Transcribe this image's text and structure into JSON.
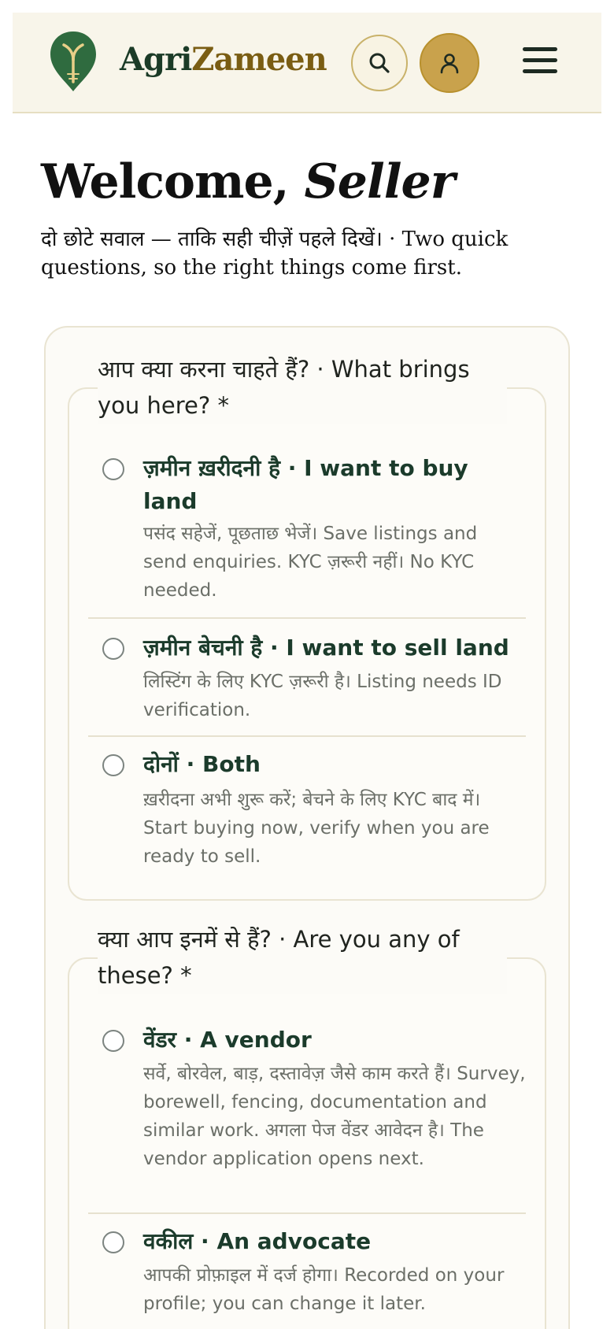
{
  "header": {
    "brand_part1": "Agri",
    "brand_part2": "Zameen",
    "logo_icon": "sprout-pin-icon",
    "search_icon": "search-icon",
    "account_icon": "user-icon",
    "menu_icon": "hamburger-menu-icon"
  },
  "colors": {
    "header_bg": "#f8f5ea",
    "brand_green": "#1b3b27",
    "brand_gold": "#7a5d13",
    "account_gold": "#c9a24c"
  },
  "welcome": {
    "prefix": "Welcome, ",
    "name": "Seller",
    "subtitle": "दो छोटे सवाल — ताकि सही चीज़ें पहले दिखें। · Two quick questions, so the right things come first."
  },
  "question1": {
    "legend": "आप क्या करना चाहते हैं? · What brings you here? *",
    "options": [
      {
        "title": "ज़मीन ख़रीदनी है · I want to buy land",
        "description": "पसंद सहेजें, पूछताछ भेजें। Save listings and send enquiries. KYC ज़रूरी नहीं। No KYC needed."
      },
      {
        "title": "ज़मीन बेचनी है · I want to sell land",
        "description": "लिस्टिंग के लिए KYC ज़रूरी है। Listing needs ID verification."
      },
      {
        "title": "दोनों · Both",
        "description": "ख़रीदना अभी शुरू करें; बेचने के लिए KYC बाद में। Start buying now, verify when you are ready to sell."
      }
    ]
  },
  "question2": {
    "legend": "क्या आप इनमें से हैं? · Are you any of these? *",
    "options": [
      {
        "title": "वेंडर · A vendor",
        "description": "सर्वे, बोरवेल, बाड़, दस्तावेज़ जैसे काम करते हैं। Survey, borewell, fencing, documentation and similar work. अगला पेज वेंडर आवेदन है। The vendor application opens next."
      },
      {
        "title": "वकील · An advocate",
        "description": "आपकी प्रोफ़ाइल में दर्ज होगा। Recorded on your profile; you can change it later."
      }
    ]
  }
}
